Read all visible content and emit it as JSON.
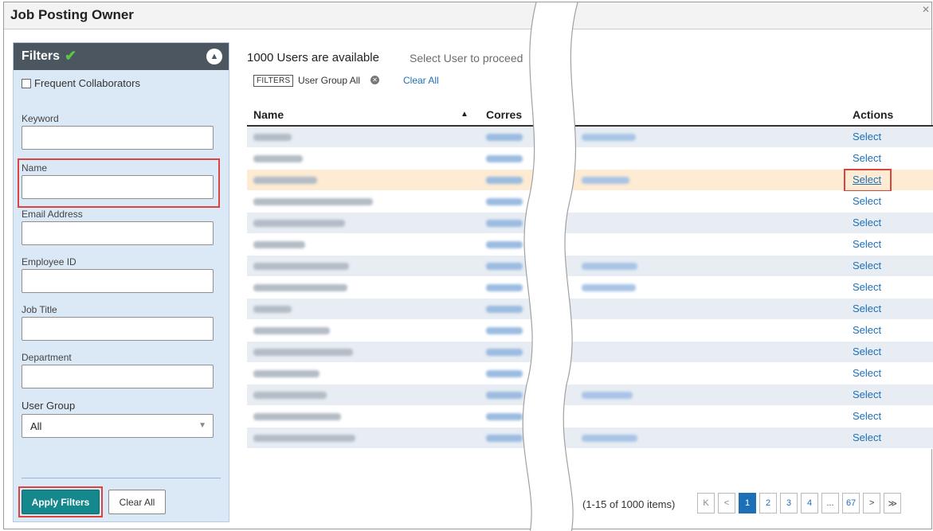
{
  "window": {
    "title": "Job Posting Owner"
  },
  "filters": {
    "title": "Filters",
    "frequent_collaborators": "Frequent Collaborators",
    "fields": [
      {
        "label": "Keyword",
        "value": ""
      },
      {
        "label": "Name",
        "value": ""
      },
      {
        "label": "Email Address",
        "value": ""
      },
      {
        "label": "Employee ID",
        "value": ""
      },
      {
        "label": "Job Title",
        "value": ""
      },
      {
        "label": "Department",
        "value": ""
      }
    ],
    "user_group": {
      "label": "User Group",
      "value": "All"
    },
    "apply_label": "Apply Filters",
    "clear_label": "Clear All"
  },
  "main": {
    "count_text": "1000 Users are available",
    "hint_text": "Select User to proceed",
    "chip_tag": "FILTERS",
    "chip_text": "User Group All",
    "clear_all": "Clear All"
  },
  "table": {
    "columns": [
      "Name",
      "Corres",
      "Actions"
    ],
    "rows": [
      {
        "action": "Select",
        "name_w": 48,
        "mail_w": 68
      },
      {
        "action": "Select",
        "name_w": 62,
        "mail_w": 0
      },
      {
        "action": "Select",
        "name_w": 80,
        "mail_w": 60,
        "highlight": true
      },
      {
        "action": "Select",
        "name_w": 150,
        "mail_w": 0
      },
      {
        "action": "Select",
        "name_w": 115,
        "mail_w": 0
      },
      {
        "action": "Select",
        "name_w": 65,
        "mail_w": 0
      },
      {
        "action": "Select",
        "name_w": 120,
        "mail_w": 70
      },
      {
        "action": "Select",
        "name_w": 118,
        "mail_w": 68
      },
      {
        "action": "Select",
        "name_w": 48,
        "mail_w": 0
      },
      {
        "action": "Select",
        "name_w": 96,
        "mail_w": 0
      },
      {
        "action": "Select",
        "name_w": 125,
        "mail_w": 0
      },
      {
        "action": "Select",
        "name_w": 83,
        "mail_w": 0
      },
      {
        "action": "Select",
        "name_w": 92,
        "mail_w": 64
      },
      {
        "action": "Select",
        "name_w": 110,
        "mail_w": 0
      },
      {
        "action": "Select",
        "name_w": 128,
        "mail_w": 70
      }
    ]
  },
  "pager": {
    "info": "(1-15 of 1000 items)",
    "first": "K",
    "prev": "<",
    "pages": [
      "1",
      "2",
      "3",
      "4",
      "...",
      "67"
    ],
    "next": ">",
    "last": "≫"
  },
  "colors": {
    "accent": "#14888c",
    "link": "#1d6fb8",
    "highlight_border": "#d9443e",
    "row_highlight": "#fdebd3"
  }
}
